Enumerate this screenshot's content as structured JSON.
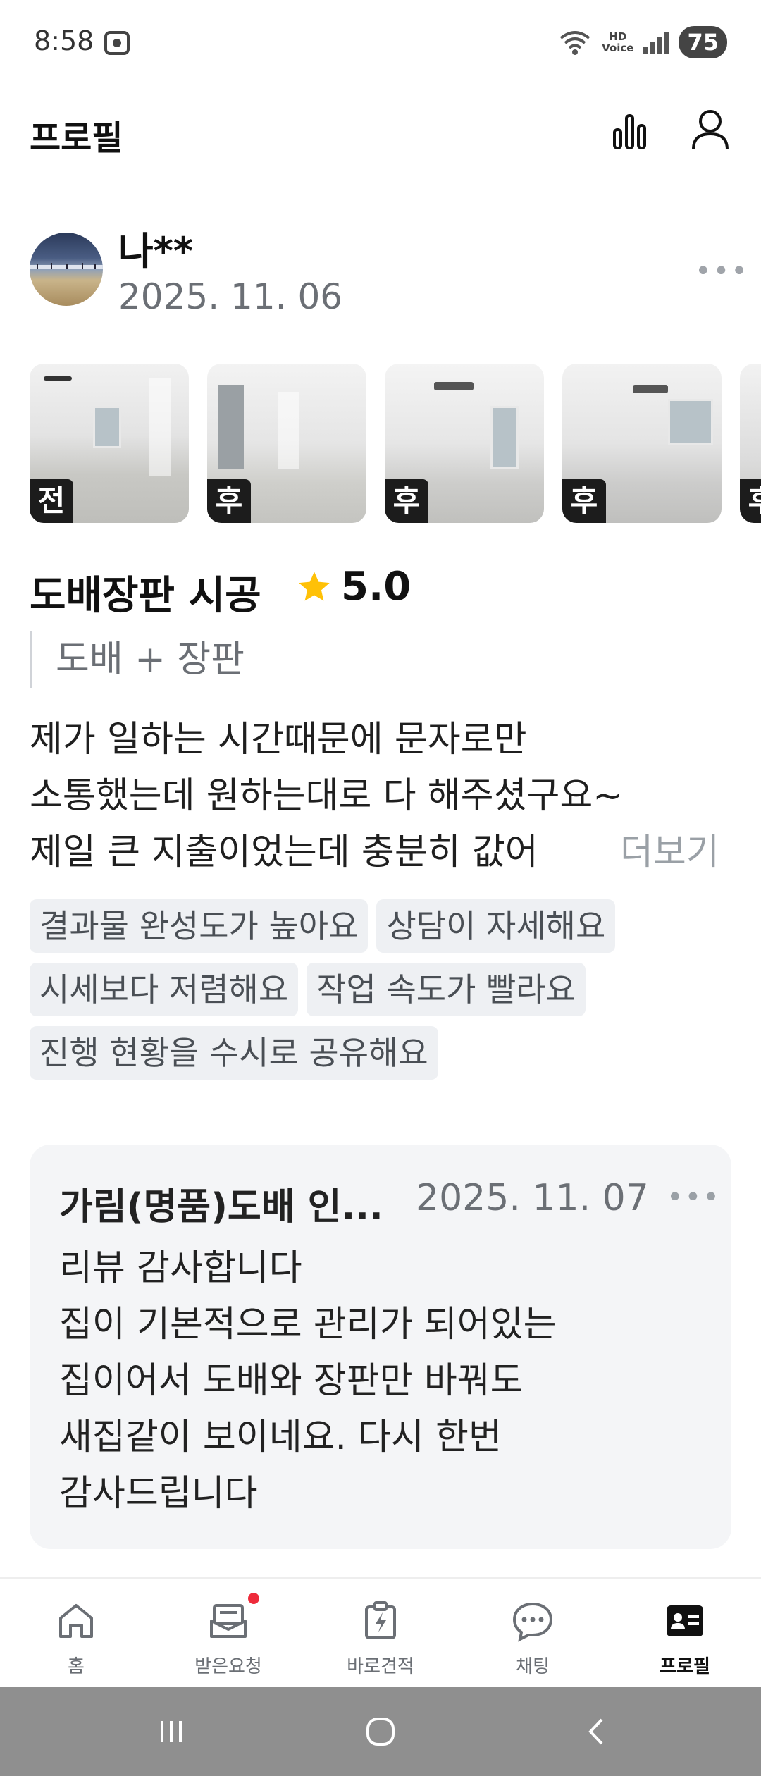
{
  "status_bar": {
    "time": "8:58",
    "hd_label_top": "HD",
    "hd_label_bottom": "Voice",
    "battery": "75",
    "icons": [
      "screenshot-icon",
      "wifi-icon",
      "hd-voice-icon",
      "signal-icon",
      "battery-icon"
    ]
  },
  "header": {
    "title": "프로필",
    "icons": [
      "stats-icon",
      "profile-icon"
    ]
  },
  "review": {
    "reviewer_name": "나**",
    "date": "2025. 11. 06",
    "photos": [
      {
        "badge": "전"
      },
      {
        "badge": "후"
      },
      {
        "badge": "후"
      },
      {
        "badge": "후"
      },
      {
        "badge": "후"
      }
    ],
    "service_title": "도배장판 시공",
    "rating": "5.0",
    "subcategory": "도배 + 장판",
    "body_lines": [
      "제가 일하는 시간때문에 문자로만",
      "소통했는데 원하는대로 다 해주셨구요~",
      "제일 큰 지출이었는데 충분히 값어"
    ],
    "read_more": "더보기",
    "tags": [
      "결과물 완성도가 높아요",
      "상담이 자세해요",
      "시세보다 저렴해요",
      "작업 속도가 빨라요",
      "진행 현황을 수시로 공유해요"
    ]
  },
  "reply": {
    "author": "가림(명품)도배 인...",
    "date": "2025. 11. 07",
    "body": "리뷰 감사합니다\n집이 기본적으로 관리가 되어있는\n집이어서  도배와 장판만 바꿔도\n새집같이 보이네요. 다시 한번\n감사드립니다"
  },
  "bottom_nav": {
    "items": [
      {
        "label": "홈",
        "icon": "home-icon"
      },
      {
        "label": "받은요청",
        "icon": "inbox-icon",
        "notification": true
      },
      {
        "label": "바로견적",
        "icon": "quick-quote-icon"
      },
      {
        "label": "채팅",
        "icon": "chat-icon"
      },
      {
        "label": "프로필",
        "icon": "profile-card-icon",
        "active": true
      }
    ]
  },
  "colors": {
    "star": "#FFC107",
    "notification_dot": "#EE2B3B",
    "tag_bg": "#EEF0F3",
    "reply_bg": "#F4F5F7"
  }
}
